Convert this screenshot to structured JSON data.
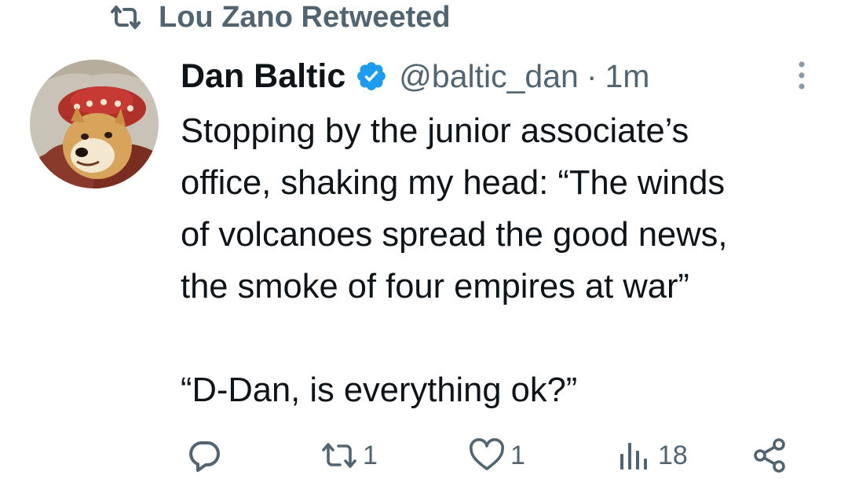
{
  "retweet": {
    "icon": "retweet-icon",
    "text": "Lou Zano Retweeted"
  },
  "author": {
    "avatar_icon": "doge-avatar",
    "display_name": "Dan Baltic",
    "verified_icon": "verified-badge-icon",
    "handle": "@baltic_dan",
    "separator": "·",
    "time": "1m"
  },
  "tweet": {
    "lines": [
      "Stopping by the junior associate’s",
      "office, shaking my head: “The winds",
      "of volcanoes spread the good news,",
      "the smoke of four empires at war”",
      "“D-Dan, is everything ok?”"
    ]
  },
  "actions": {
    "reply": {
      "icon": "reply-icon",
      "count": ""
    },
    "retweet": {
      "icon": "retweet-icon",
      "count": "1"
    },
    "like": {
      "icon": "heart-icon",
      "count": "1"
    },
    "views": {
      "icon": "views-icon",
      "count": "18"
    },
    "share": {
      "icon": "share-icon"
    }
  },
  "colors": {
    "text": "#0f1419",
    "secondary": "#536471",
    "verified": "#1d9bf0"
  }
}
